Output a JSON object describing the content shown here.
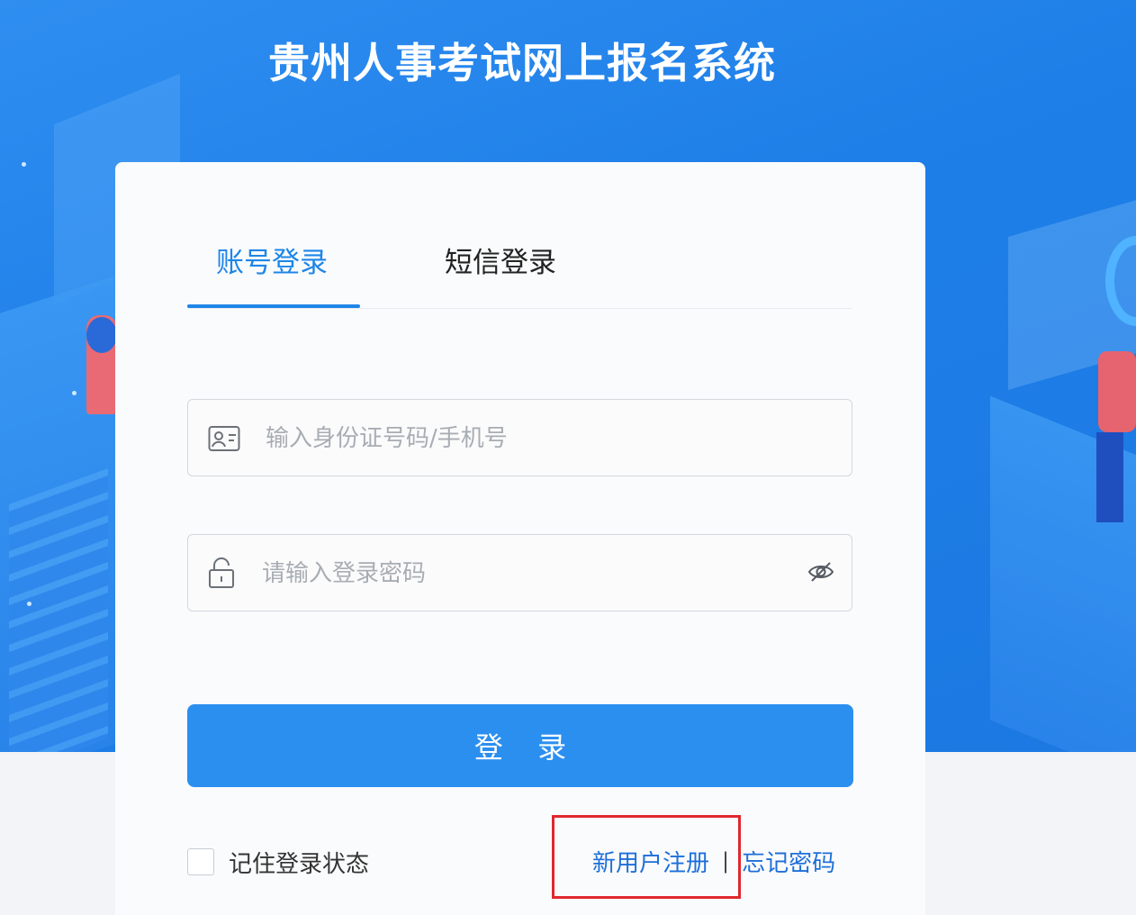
{
  "site": {
    "title": "贵州人事考试网上报名系统"
  },
  "tabs": {
    "account_login": "账号登录",
    "sms_login": "短信登录"
  },
  "form": {
    "account_placeholder": "输入身份证号码/手机号",
    "account_value": "",
    "password_placeholder": "请输入登录密码",
    "password_value": "",
    "login_button": "登 录",
    "remember_label": "记住登录状态",
    "remember_checked": false
  },
  "links": {
    "register": "新用户注册",
    "separator": "|",
    "forgot_password": "忘记密码"
  },
  "icons": {
    "account": "id-card-icon",
    "password": "lock-icon",
    "toggle_visibility": "eye-off-icon"
  },
  "colors": {
    "primary": "#2b8ff0",
    "active_tab": "#1e86e8",
    "link": "#1e6fd9",
    "highlight": "#e0282e",
    "hero_bg": "#1e7fe8"
  }
}
